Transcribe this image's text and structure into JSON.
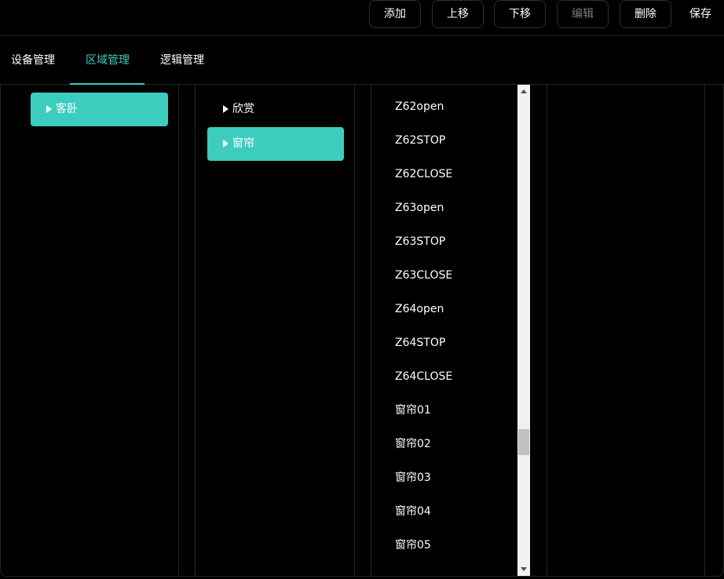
{
  "toolbar": {
    "add": "添加",
    "move_up": "上移",
    "move_down": "下移",
    "edit": "编辑",
    "delete": "删除",
    "save": "保存"
  },
  "tabs": [
    {
      "label": "设备管理",
      "active": false
    },
    {
      "label": "区域管理",
      "active": true
    },
    {
      "label": "逻辑管理",
      "active": false
    }
  ],
  "areas": [
    {
      "label": "客卧",
      "selected": true
    }
  ],
  "groups": [
    {
      "label": "欣赏",
      "selected": false
    },
    {
      "label": "窗帘",
      "selected": true
    }
  ],
  "commands": [
    "Z62open",
    "Z62STOP",
    "Z62CLOSE",
    "Z63open",
    "Z63STOP",
    "Z63CLOSE",
    "Z64open",
    "Z64STOP",
    "Z64CLOSE",
    "窗帘01",
    "窗帘02",
    "窗帘03",
    "窗帘04",
    "窗帘05"
  ],
  "colors": {
    "accent": "#3dcdbe",
    "background": "#000000",
    "disabled_text": "#7c7c7c"
  },
  "icons": {
    "expand": "caret-right-icon",
    "scroll_up": "scroll-up-arrow-icon",
    "scroll_down": "scroll-down-arrow-icon"
  }
}
